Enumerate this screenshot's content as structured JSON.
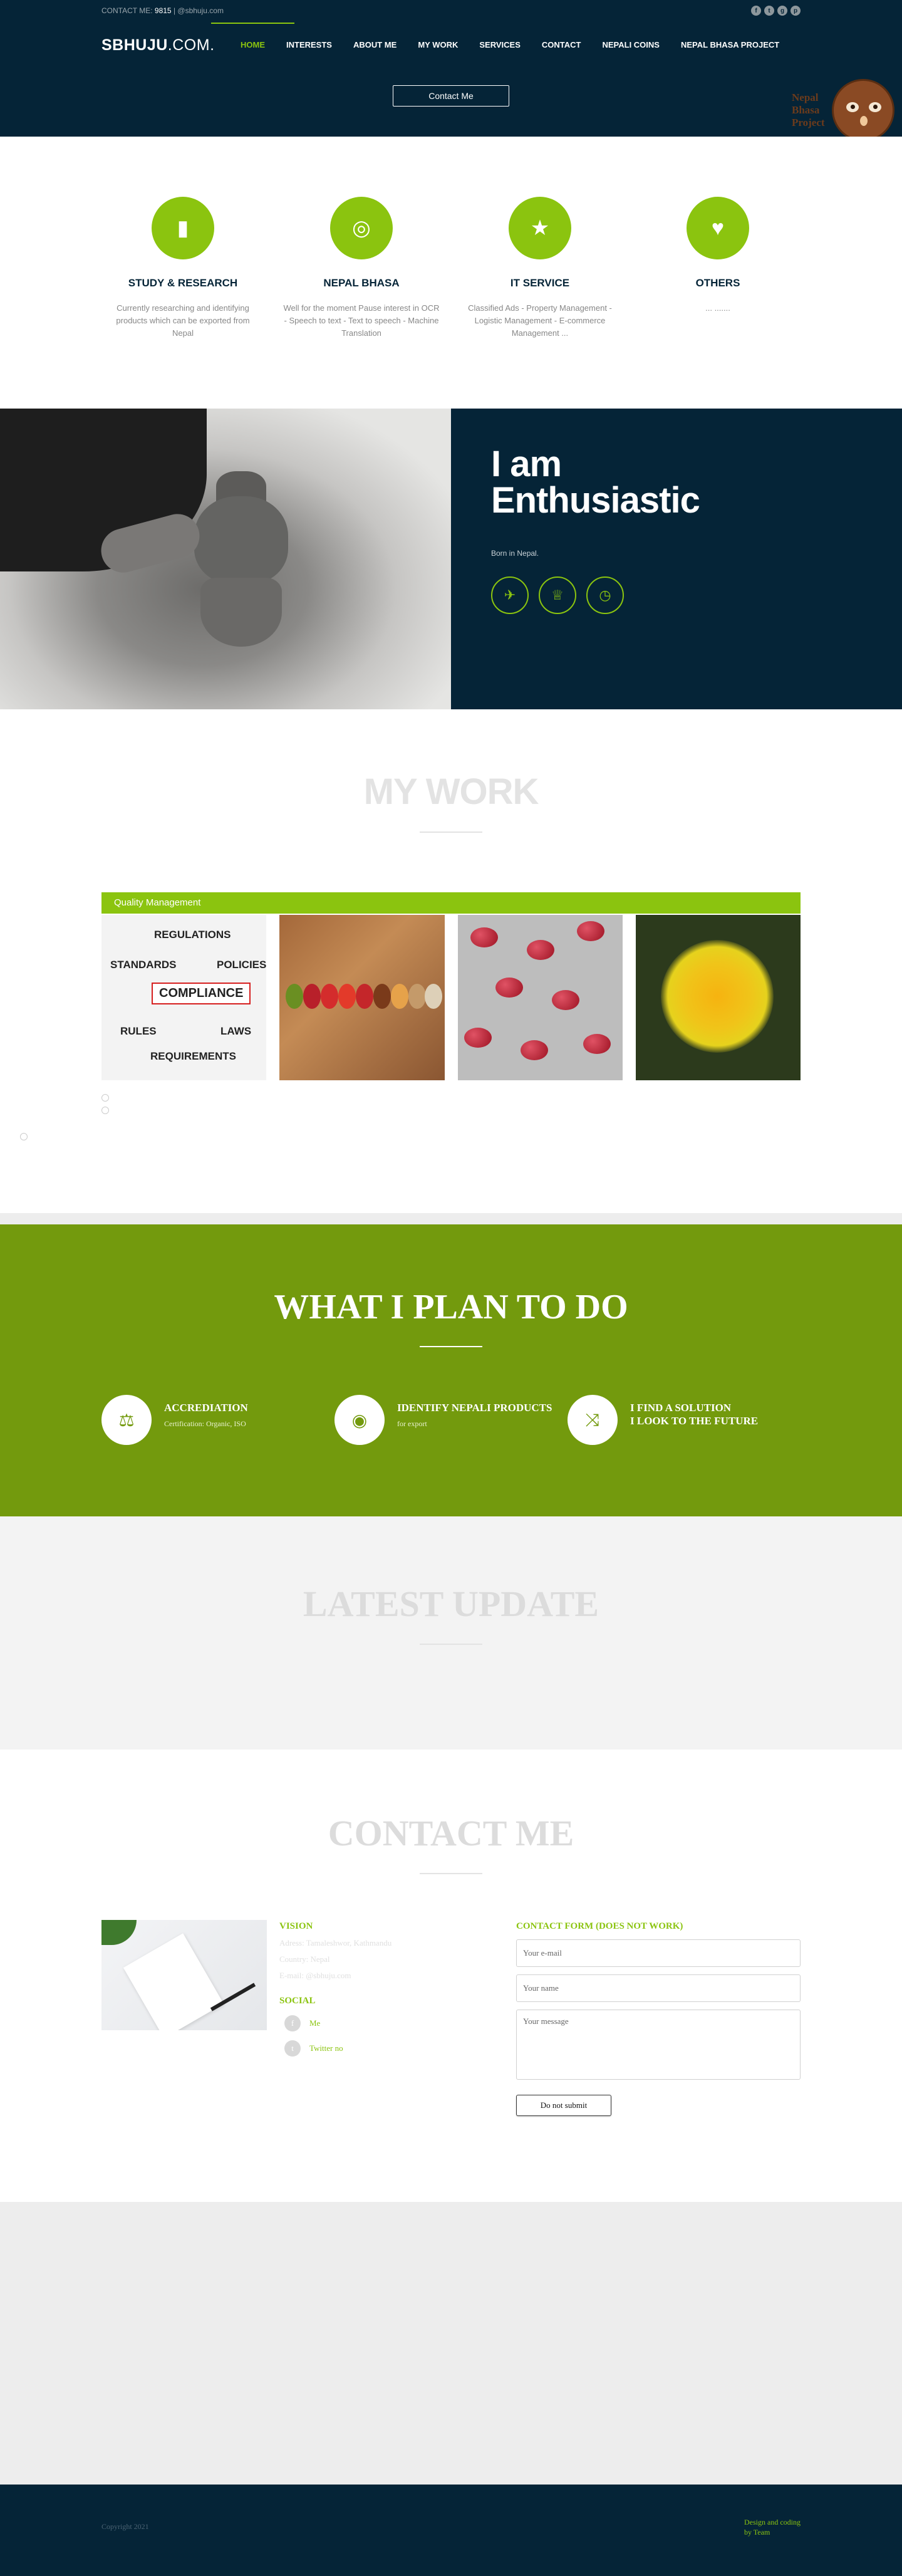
{
  "topbar": {
    "contact_prefix": "CONTACT ME:",
    "contact_number": "9815",
    "contact_email": "| @sbhuju.com",
    "social_icons": [
      "facebook-icon",
      "twitter-icon",
      "google-icon",
      "pinterest-icon"
    ]
  },
  "header": {
    "logo_bold": "SBHUJU",
    "logo_thin": ".COM.",
    "nav": [
      "HOME",
      "INTERESTS",
      "ABOUT ME",
      "MY WORK",
      "SERVICES",
      "CONTACT",
      "NEPALI COINS",
      "NEPAL BHASA PROJECT"
    ],
    "cta": "Contact Me",
    "badge_lines": [
      "Nepal",
      "Bhasa",
      "Project"
    ]
  },
  "services": [
    {
      "title": "STUDY & RESEARCH",
      "text": "Currently researching and identifying products which can be exported from Nepal",
      "icon": "book-icon"
    },
    {
      "title": "NEPAL BHASA",
      "text": "Well for the moment Pause interest in OCR - Speech to text - Text to speech - Machine Translation",
      "icon": "compass-icon"
    },
    {
      "title": "IT SERVICE",
      "text": "Classified Ads - Property Management - Logistic Management - E-commerce Management ...",
      "icon": "star-icon"
    },
    {
      "title": "OTHERS",
      "text": "... .......",
      "icon": "heart-icon"
    }
  ],
  "hero": {
    "title_line1": "I am",
    "title_line2": "Enthusiastic",
    "subtitle": "Born in Nepal.",
    "icons": [
      "plane-icon",
      "trophy-icon",
      "clock-icon"
    ]
  },
  "mywork": {
    "title": "MY WORK",
    "tab": "Quality Management",
    "compliance_words": [
      "REGULATIONS",
      "STANDARDS",
      "POLICIES",
      "COMPLIANCE",
      "RULES",
      "LAWS",
      "REQUIREMENTS"
    ]
  },
  "plan": {
    "title": "WHAT I PLAN TO DO",
    "items": [
      {
        "title": "ACCREDIATION",
        "text": "Certification: Organic, ISO",
        "icon": "scale-icon"
      },
      {
        "title": "IDENTIFY NEPALI PRODUCTS",
        "text": "for export",
        "icon": "eye-icon"
      },
      {
        "title": "I FIND A SOLUTION",
        "title2": "I LOOK TO THE FUTURE",
        "text": "",
        "icon": "shuffle-icon"
      }
    ]
  },
  "latest": {
    "title": "LATEST UPDATE"
  },
  "contact": {
    "title": "CONTACT ME",
    "vision_title": "VISION",
    "vision_rows": [
      "Adress: Tamaleshwor, Kathmandu",
      "Country: Nepal",
      "E-mail: @sbhuju.com"
    ],
    "social_title": "SOCIAL",
    "social_rows": [
      {
        "label": "Me",
        "icon": "facebook-icon"
      },
      {
        "label": "Twitter no",
        "icon": "twitter-icon"
      }
    ],
    "form_title": "CONTACT FORM (DOES NOT WORK)",
    "email_placeholder": "Your e-mail",
    "name_placeholder": "Your name",
    "message_placeholder": "Your message",
    "submit": "Do not submit"
  },
  "footer": {
    "copyright": "Copyright 2021",
    "credit_line1": "Design and coding",
    "credit_line2": "by Team"
  },
  "colors": {
    "navy": "#052437",
    "accent": "#8bc40f",
    "plan_green": "#739a0d"
  }
}
